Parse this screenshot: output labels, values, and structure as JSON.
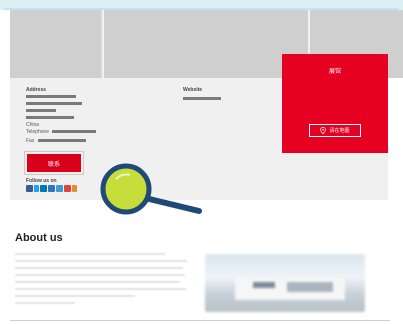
{
  "address": {
    "heading": "Address",
    "country": "China",
    "telephone_label": "Telephone",
    "fax_label": "Fax",
    "contact_button": "联系",
    "follow_label": "Follow us on"
  },
  "website": {
    "heading": "Website"
  },
  "pavilion": {
    "title": "展馆",
    "map_button": "请在地图",
    "map_icon": "location-pin-icon"
  },
  "about": {
    "title": "About us"
  },
  "colors": {
    "brand_red": "#e60021",
    "button_red": "#d9001b",
    "panel_bg": "#f0f0f0",
    "magnifier_lens": "#c6dd3c",
    "magnifier_handle": "#1f4a78"
  },
  "social_icons": [
    "facebook-icon",
    "twitter-icon",
    "linkedin-icon",
    "youtube-icon",
    "weibo-icon",
    "wechat-icon",
    "other-icon"
  ]
}
